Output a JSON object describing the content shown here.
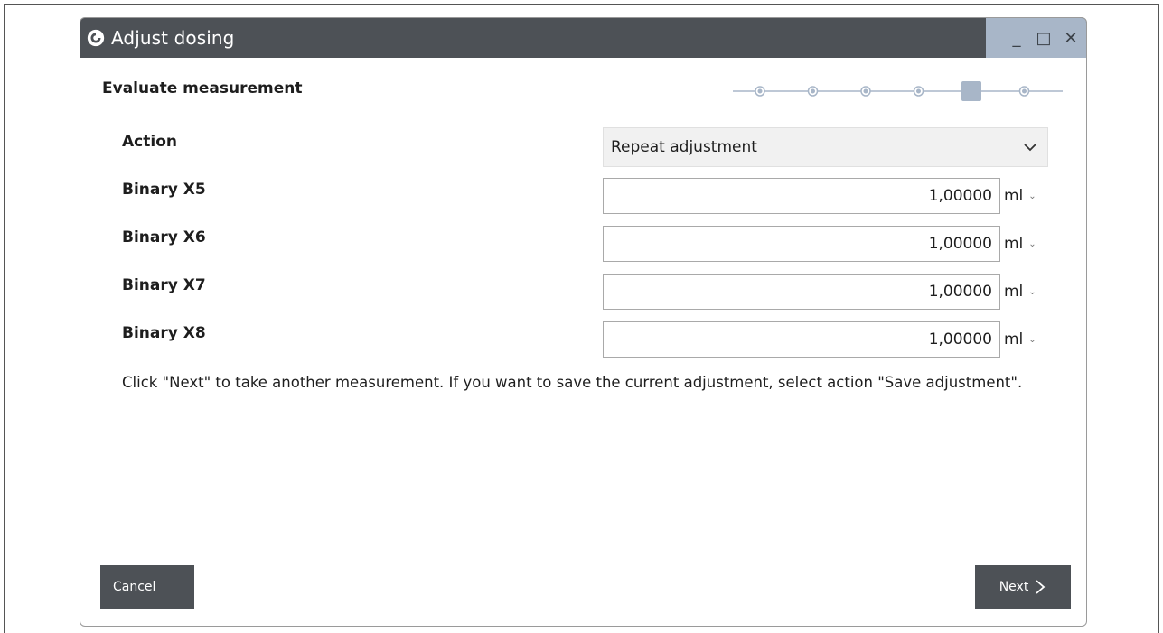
{
  "window": {
    "title": "Adjust dosing",
    "minimize_label": "_",
    "maximize_label": "□",
    "close_label": "✕"
  },
  "header": {
    "step_title": "Evaluate measurement",
    "steps_total": 6,
    "current_step": 5
  },
  "form": {
    "action": {
      "label": "Action",
      "selected": "Repeat adjustment"
    },
    "rows": [
      {
        "label": "Binary X5",
        "value": "1,00000",
        "unit": "ml"
      },
      {
        "label": "Binary X6",
        "value": "1,00000",
        "unit": "ml"
      },
      {
        "label": "Binary X7",
        "value": "1,00000",
        "unit": "ml"
      },
      {
        "label": "Binary X8",
        "value": "1,00000",
        "unit": "ml"
      }
    ]
  },
  "help_text": "Click \"Next\" to take another measurement. If you want to save the current adjustment, select action \"Save adjustment\".",
  "footer": {
    "cancel_label": "Cancel",
    "next_label": "Next"
  },
  "colors": {
    "titlebar": "#4d5156",
    "titlebar_controls": "#a8b6c8",
    "stepper_active": "#a8b6c8",
    "button_bg": "#4d5156"
  },
  "icons": {
    "app": "app-logo-icon",
    "dropdown": "chevron-down-icon",
    "next": "chevron-right-icon"
  }
}
